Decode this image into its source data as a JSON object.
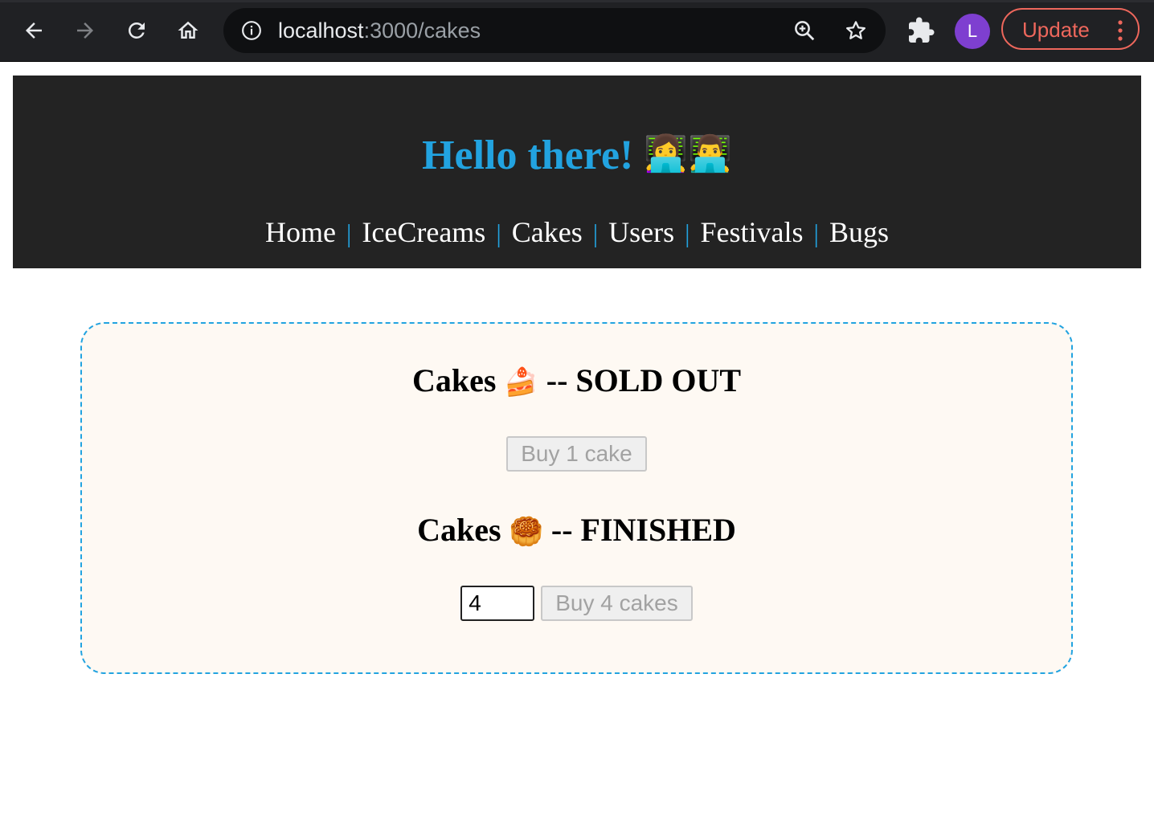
{
  "browser": {
    "url_host": "localhost",
    "url_path": ":3000/cakes",
    "avatar_letter": "L",
    "update_label": "Update",
    "icons": [
      "back-icon",
      "forward-icon",
      "reload-icon",
      "home-icon",
      "info-icon",
      "zoom-icon",
      "star-icon",
      "extensions-icon",
      "more-icon"
    ]
  },
  "header": {
    "title": "Hello there!",
    "title_emoji": "👩‍💻👨‍💻",
    "nav": {
      "home": "Home",
      "icecreams": "IceCreams",
      "cakes": "Cakes",
      "users": "Users",
      "festivals": "Festivals",
      "bugs": "Bugs",
      "separator": "|"
    }
  },
  "cakes": {
    "section1": {
      "heading_prefix": "Cakes",
      "emoji": "🍰",
      "heading_suffix": "-- SOLD OUT",
      "button_label": "Buy 1 cake",
      "button_disabled": true
    },
    "section2": {
      "heading_prefix": "Cakes",
      "emoji": "🥮",
      "heading_suffix": "-- FINISHED",
      "quantity_value": "4",
      "button_label": "Buy 4 cakes",
      "button_disabled": true
    }
  },
  "colors": {
    "accent": "#22a3e0",
    "header_bg": "#232323",
    "card_bg": "#fef9f3",
    "update": "#ee675c",
    "avatar": "#7e3fd0"
  }
}
